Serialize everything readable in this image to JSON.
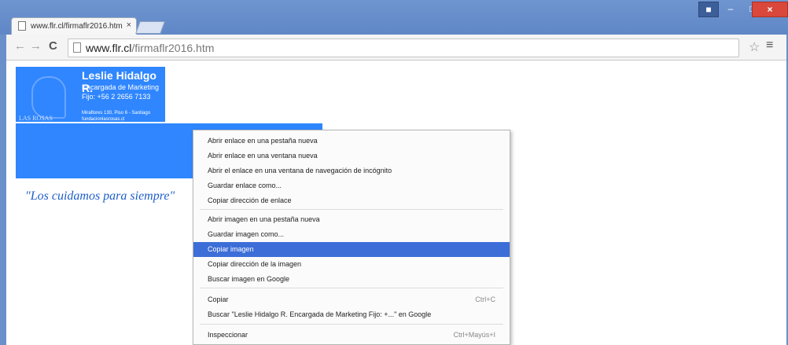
{
  "tab": {
    "title": "www.flr.cl/firmaflr2016.htm",
    "close_glyph": "×"
  },
  "window": {
    "min_glyph": "–",
    "max_glyph": "□",
    "close_glyph": "×"
  },
  "nav": {
    "back": "←",
    "forward": "→",
    "reload": "C"
  },
  "address": {
    "domain": "www.flr.cl",
    "path": "/firmaflr2016.htm"
  },
  "toolbar_icons": {
    "star": "☆",
    "menu": "≡"
  },
  "signature": {
    "name": "Leslie Hidalgo R.",
    "role": "Encargada de Marketing",
    "phone": "Fijo: +56 2 2656 7133",
    "address": "Miraflores 130, Piso 6 - Santiago",
    "email": "fundacionlasrosas.cl",
    "logo_text": "LAS ROSAS",
    "slogan": "\"Los cuidamos para siempre\""
  },
  "context_menu": {
    "group1": [
      "Abrir enlace en una pestaña nueva",
      "Abrir enlace en una ventana nueva",
      "Abrir el enlace en una ventana de navegación de incógnito",
      "Guardar enlace como...",
      "Copiar dirección de enlace"
    ],
    "group2": [
      "Abrir imagen en una pestaña nueva",
      "Guardar imagen como...",
      "Copiar imagen",
      "Copiar dirección de la imagen",
      "Buscar imagen en Google"
    ],
    "group3": [
      {
        "label": "Copiar",
        "shortcut": "Ctrl+C"
      },
      {
        "label": "Buscar \"Leslie Hidalgo R. Encargada de Marketing Fijo: +...\" en Google",
        "shortcut": ""
      }
    ],
    "group4": [
      {
        "label": "Inspeccionar",
        "shortcut": "Ctrl+Mayús+I"
      }
    ],
    "active_item": "Copiar imagen"
  },
  "colors": {
    "selection": "#2f86ff",
    "menu_highlight": "#3d6ed8",
    "title_bar": "#6a90c9"
  }
}
